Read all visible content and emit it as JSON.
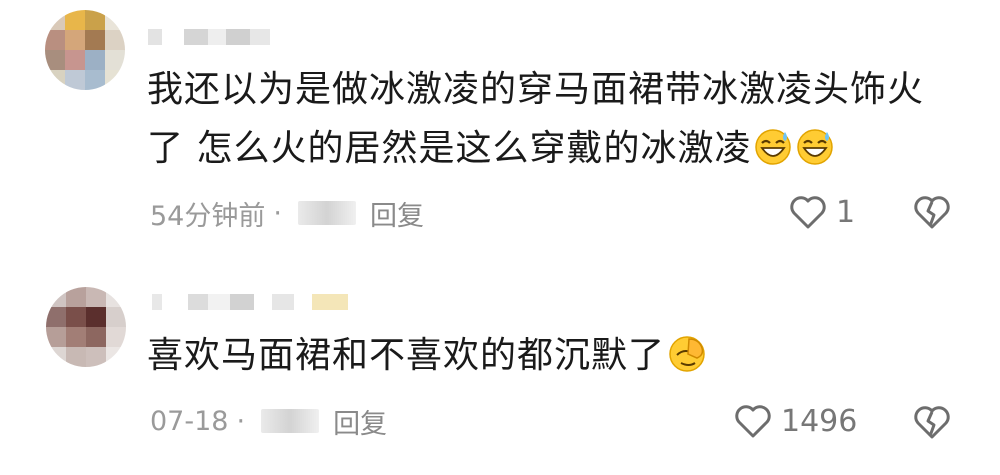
{
  "comments": [
    {
      "text": "我还以为是做冰激凌的穿马面裙带冰激凌头饰火了 怎么火的居然是这么穿戴的冰激凌",
      "emojis": [
        "sweat-grin-emoji",
        "sweat-grin-emoji"
      ],
      "time": "54分钟前",
      "separator": "·",
      "location_glyph": "苏",
      "reply_label": "回复",
      "like_count": "1"
    },
    {
      "text": "喜欢马面裙和不喜欢的都沉默了",
      "emojis": [
        "facepalm-emoji"
      ],
      "time": "07-18",
      "separator": "·",
      "location_glyph": "南",
      "reply_label": "回复",
      "like_count": "1496"
    }
  ],
  "colors": {
    "text": "#1a1a1a",
    "meta": "#9a9a9a",
    "icon": "#777777",
    "emoji": "#ffcc33"
  }
}
